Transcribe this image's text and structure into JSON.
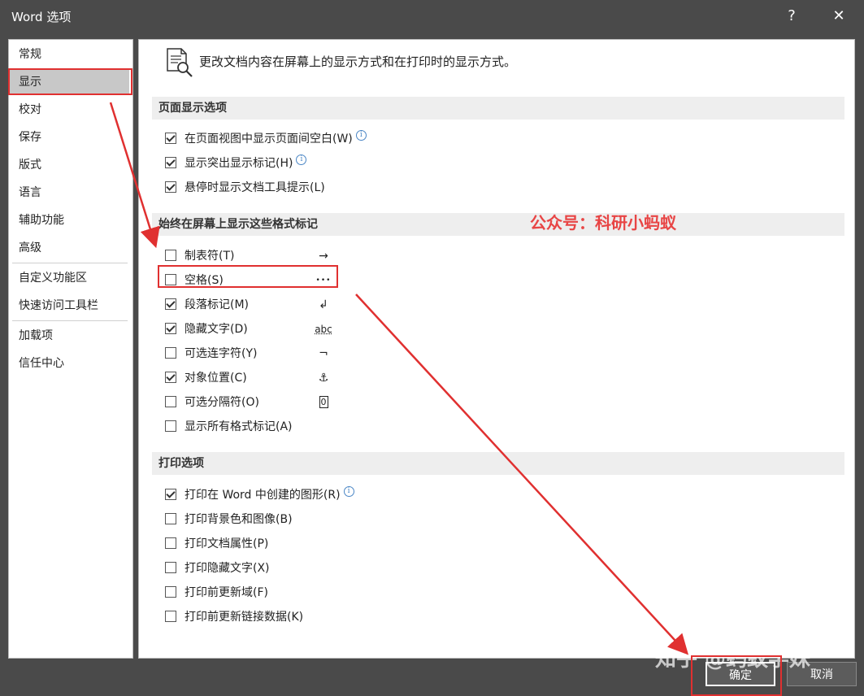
{
  "window": {
    "title": "Word 选项",
    "help_label": "?",
    "close_label": "✕"
  },
  "sidebar": {
    "items": [
      {
        "label": "常规"
      },
      {
        "label": "显示"
      },
      {
        "label": "校对"
      },
      {
        "label": "保存"
      },
      {
        "label": "版式"
      },
      {
        "label": "语言"
      },
      {
        "label": "辅助功能"
      },
      {
        "label": "高级"
      },
      {
        "label": "自定义功能区"
      },
      {
        "label": "快速访问工具栏"
      },
      {
        "label": "加载项"
      },
      {
        "label": "信任中心"
      }
    ],
    "selected": "显示"
  },
  "header": {
    "text": "更改文档内容在屏幕上的显示方式和在打印时的显示方式。",
    "icon": "document-search-icon"
  },
  "page_display": {
    "title": "页面显示选项",
    "options": [
      {
        "label": "在页面视图中显示页面间空白(W)",
        "checked": true,
        "info": "i"
      },
      {
        "label": "显示突出显示标记(H)",
        "checked": true,
        "info": "i"
      },
      {
        "label": "悬停时显示文档工具提示(L)",
        "checked": true
      }
    ]
  },
  "format_marks": {
    "title": "始终在屏幕上显示这些格式标记",
    "options": [
      {
        "label": "制表符(T)",
        "checked": false,
        "symbol": "→"
      },
      {
        "label": "空格(S)",
        "checked": false,
        "symbol": "•••"
      },
      {
        "label": "段落标记(M)",
        "checked": true,
        "symbol": "↲"
      },
      {
        "label": "隐藏文字(D)",
        "checked": true,
        "symbol": "abc"
      },
      {
        "label": "可选连字符(Y)",
        "checked": false,
        "symbol": "¬"
      },
      {
        "label": "对象位置(C)",
        "checked": true,
        "symbol": "⚓"
      },
      {
        "label": "可选分隔符(O)",
        "checked": false,
        "symbol": "0"
      },
      {
        "label": "显示所有格式标记(A)",
        "checked": false
      }
    ]
  },
  "print_options": {
    "title": "打印选项",
    "options": [
      {
        "label": "打印在 Word 中创建的图形(R)",
        "checked": true,
        "info": "i"
      },
      {
        "label": "打印背景色和图像(B)",
        "checked": false
      },
      {
        "label": "打印文档属性(P)",
        "checked": false
      },
      {
        "label": "打印隐藏文字(X)",
        "checked": false
      },
      {
        "label": "打印前更新域(F)",
        "checked": false
      },
      {
        "label": "打印前更新链接数据(K)",
        "checked": false
      }
    ]
  },
  "annotation": {
    "text": "公众号：科研小蚂蚁",
    "color": "#e84545"
  },
  "buttons": {
    "ok": "确定",
    "cancel": "取消"
  },
  "watermark": "知乎 @蚂蚁学妹"
}
